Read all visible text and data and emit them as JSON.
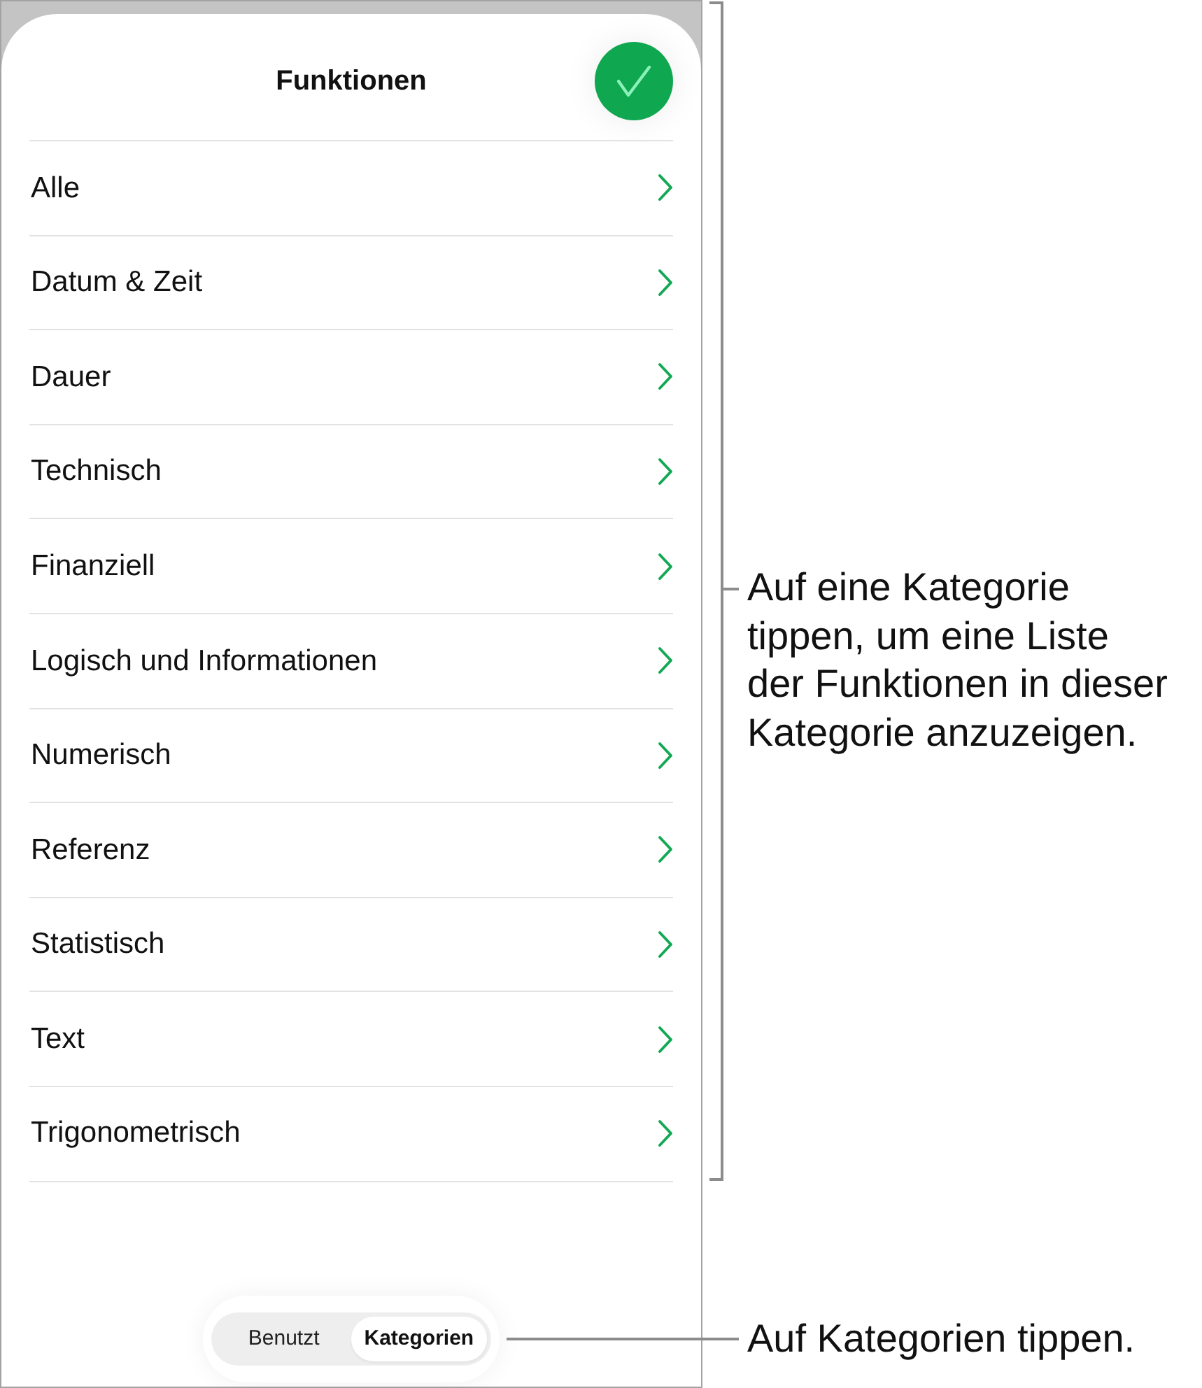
{
  "sheet": {
    "title": "Funktionen"
  },
  "categories": [
    {
      "label": "Alle"
    },
    {
      "label": "Datum & Zeit"
    },
    {
      "label": "Dauer"
    },
    {
      "label": "Technisch"
    },
    {
      "label": "Finanziell"
    },
    {
      "label": "Logisch und Informationen"
    },
    {
      "label": "Numerisch"
    },
    {
      "label": "Referenz"
    },
    {
      "label": "Statistisch"
    },
    {
      "label": "Text"
    },
    {
      "label": "Trigonometrisch"
    }
  ],
  "segmented_control": [
    {
      "label": "Benutzt",
      "selected": false
    },
    {
      "label": "Kategorien",
      "selected": true
    }
  ],
  "callouts": [
    {
      "kind": "bracket",
      "text": "Auf eine Kategorie\ntippen, um eine Liste\nder Funktionen in dieser\nKategorie anzuzeigen."
    },
    {
      "kind": "pointer",
      "text": "Auf Kategorien tippen."
    }
  ]
}
